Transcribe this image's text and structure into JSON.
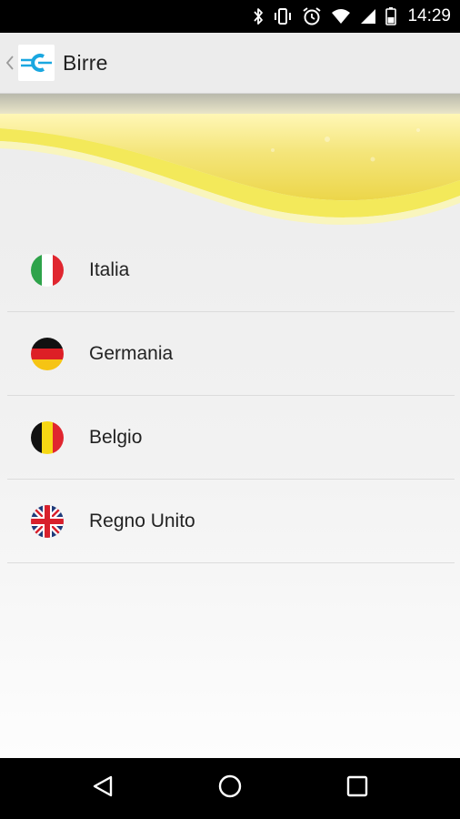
{
  "status_bar": {
    "time": "14:29",
    "icons": [
      "bluetooth-icon",
      "vibrate-icon",
      "alarm-icon",
      "wifi-icon",
      "cell-signal-icon",
      "battery-icon"
    ]
  },
  "action_bar": {
    "title": "Birre",
    "up_icon": "chevron-left-icon",
    "logo_icon": "app-logo-icon"
  },
  "countries": [
    {
      "label": "Italia",
      "flag": "italy-flag-icon"
    },
    {
      "label": "Germania",
      "flag": "germany-flag-icon"
    },
    {
      "label": "Belgio",
      "flag": "belgium-flag-icon"
    },
    {
      "label": "Regno Unito",
      "flag": "uk-flag-icon"
    }
  ],
  "nav_bar": {
    "buttons": [
      "back-icon",
      "home-icon",
      "recents-icon"
    ]
  },
  "colors": {
    "beer_yellow": "#f0e04a",
    "logo_blue": "#1aa7e0"
  }
}
